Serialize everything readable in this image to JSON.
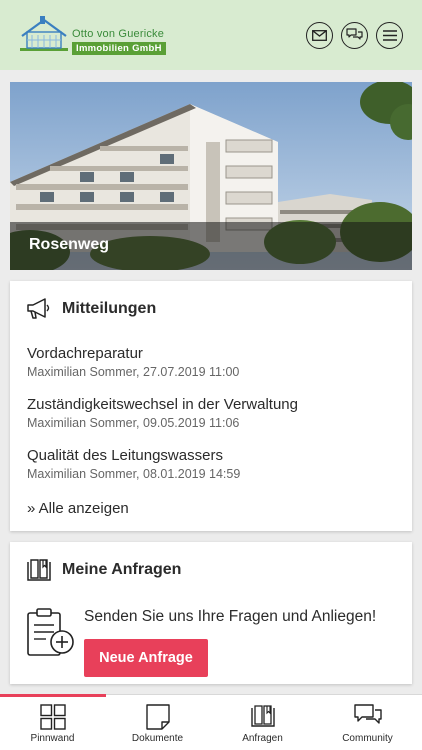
{
  "header": {
    "logo_line1": "Otto von Guericke",
    "logo_line2": "Immobilien GmbH",
    "icons": [
      "mail-icon",
      "chat-icon",
      "menu-icon"
    ]
  },
  "hero": {
    "property_name": "Rosenweg"
  },
  "announcements": {
    "title": "Mitteilungen",
    "icon": "megaphone-icon",
    "items": [
      {
        "title": "Vordachreparatur",
        "meta": "Maximilian Sommer, 27.07.2019 11:00"
      },
      {
        "title": "Zuständigkeitswechsel in der Verwaltung",
        "meta": "Maximilian Sommer, 09.05.2019 11:06"
      },
      {
        "title": "Qualität des Leitungswassers",
        "meta": "Maximilian Sommer, 08.01.2019 14:59"
      }
    ],
    "show_all": "» Alle anzeigen"
  },
  "requests": {
    "title": "Meine Anfragen",
    "icon": "book-icon",
    "prompt": "Senden Sie uns Ihre Fragen und Anliegen!",
    "button": "Neue Anfrage"
  },
  "tabbar": {
    "active_index": 0,
    "accent": "#e8405a",
    "tabs": [
      {
        "label": "Pinnwand",
        "icon": "grid-icon"
      },
      {
        "label": "Dokumente",
        "icon": "document-icon"
      },
      {
        "label": "Anfragen",
        "icon": "book-icon"
      },
      {
        "label": "Community",
        "icon": "chat-icon"
      }
    ]
  }
}
